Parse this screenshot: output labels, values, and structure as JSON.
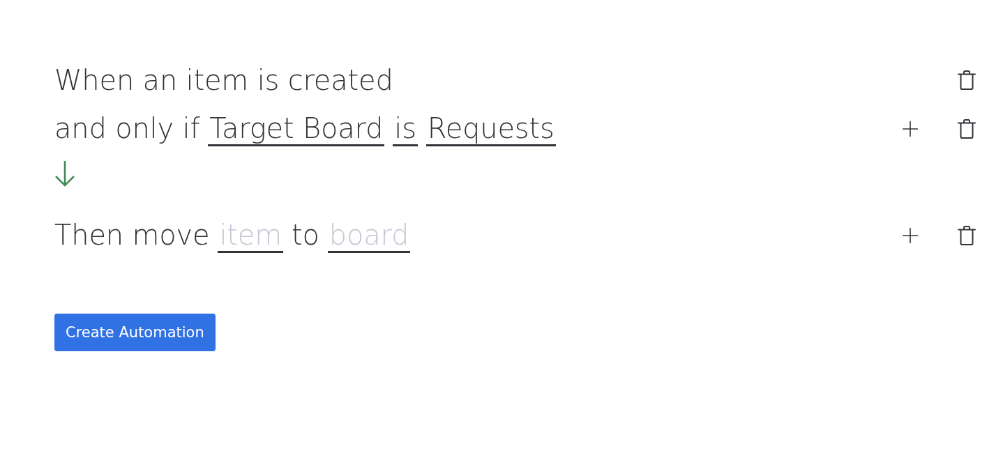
{
  "flow": [
    {
      "kind": "trigger",
      "can_add": false,
      "parts": [
        {
          "kind": "text",
          "text": "When an item is created"
        }
      ]
    },
    {
      "kind": "condition",
      "can_add": true,
      "parts": [
        {
          "kind": "text",
          "text": "and only if"
        },
        {
          "kind": "field",
          "value": "Target Board"
        },
        {
          "kind": "field",
          "value": "is"
        },
        {
          "kind": "field",
          "value": "Requests"
        }
      ]
    },
    {
      "kind": "arrow"
    },
    {
      "kind": "action",
      "can_add": true,
      "parts": [
        {
          "kind": "text",
          "text": "Then move"
        },
        {
          "kind": "field",
          "placeholder": "item"
        },
        {
          "kind": "text",
          "text": "to"
        },
        {
          "kind": "field",
          "placeholder": "board"
        }
      ]
    }
  ],
  "submit_button": {
    "label": "Create Automation"
  }
}
